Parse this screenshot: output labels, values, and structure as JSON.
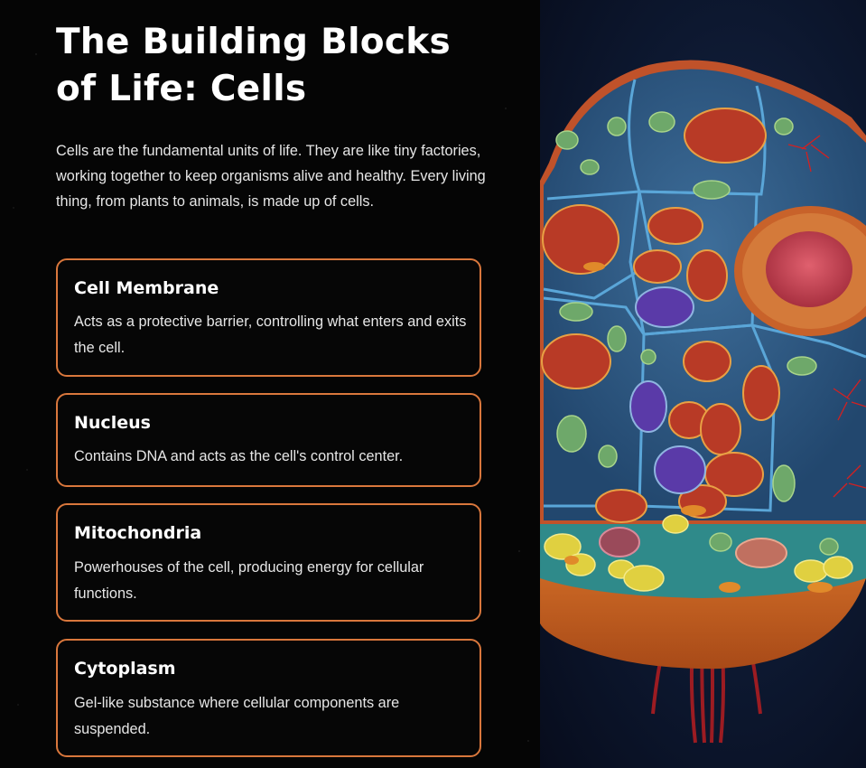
{
  "title": "The Building Blocks of Life: Cells",
  "intro": "Cells are the fundamental units of life. They are like tiny factories, working together to keep organisms alive and healthy. Every living thing, from plants to animals, is made up of cells.",
  "cards": [
    {
      "title": "Cell Membrane",
      "description": "Acts as a protective barrier, controlling what enters and exits the cell."
    },
    {
      "title": "Nucleus",
      "description": "Contains DNA and acts as the cell's control center."
    },
    {
      "title": "Mitochondria",
      "description": "Powerhouses of the cell, producing energy for cellular functions."
    },
    {
      "title": "Cytoplasm",
      "description": "Gel-like substance where cellular components are suspended."
    }
  ],
  "colors": {
    "background": "#050505",
    "card_border": "#d9773c",
    "text": "#ffffff",
    "image_background": "#0d1830"
  }
}
